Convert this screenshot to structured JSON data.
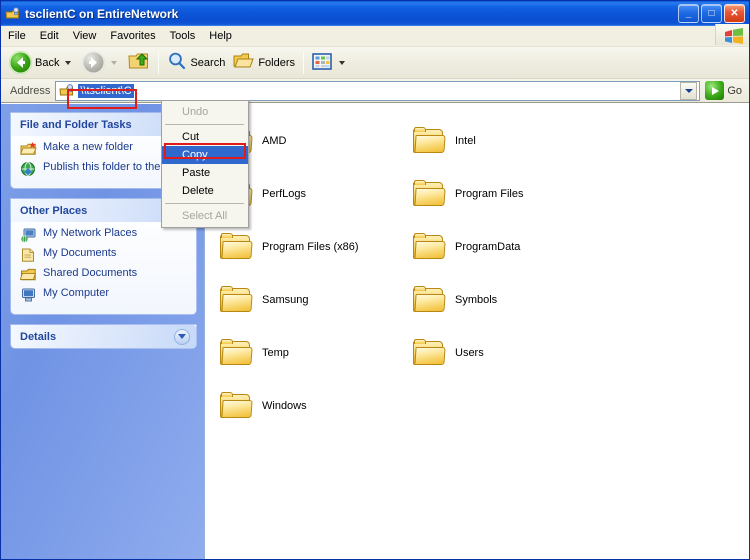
{
  "window": {
    "title": "tsclientC on EntireNetwork",
    "icon": "network-folder-icon",
    "controls": {
      "minimize": "_",
      "maximize": "□",
      "close": "✕"
    }
  },
  "menubar": {
    "items": [
      {
        "label": "File"
      },
      {
        "label": "Edit"
      },
      {
        "label": "View"
      },
      {
        "label": "Favorites"
      },
      {
        "label": "Tools"
      },
      {
        "label": "Help"
      }
    ],
    "logo": "windows-flag-icon"
  },
  "toolbar": {
    "back_label": "Back",
    "forward_label": "",
    "search_label": "Search",
    "folders_label": "Folders",
    "views_label": ""
  },
  "address": {
    "label": "Address",
    "value": "\\\\tsclient\\C",
    "go_label": "Go"
  },
  "sidebar": {
    "panels": [
      {
        "title": "File and Folder Tasks",
        "toggle": "collapse-up",
        "items": [
          {
            "icon": "new-folder-icon",
            "label": "Make a new folder"
          },
          {
            "icon": "publish-web-icon",
            "label": "Publish this folder to the Web"
          }
        ]
      },
      {
        "title": "Other Places",
        "toggle": "collapse-up",
        "items": [
          {
            "icon": "network-places-icon",
            "label": "My Network Places"
          },
          {
            "icon": "my-documents-icon",
            "label": "My Documents"
          },
          {
            "icon": "shared-documents-icon",
            "label": "Shared Documents"
          },
          {
            "icon": "my-computer-icon",
            "label": "My Computer"
          }
        ]
      },
      {
        "title": "Details",
        "toggle": "expand-down",
        "items": []
      }
    ]
  },
  "folders": [
    {
      "name": "AMD"
    },
    {
      "name": "Intel"
    },
    {
      "name": "PerfLogs"
    },
    {
      "name": "Program Files"
    },
    {
      "name": "Program Files (x86)"
    },
    {
      "name": "ProgramData"
    },
    {
      "name": "Samsung"
    },
    {
      "name": "Symbols"
    },
    {
      "name": "Temp"
    },
    {
      "name": "Users"
    },
    {
      "name": "Windows"
    }
  ],
  "context_menu": {
    "items": [
      {
        "label": "Undo",
        "state": "disabled"
      },
      {
        "label": "-separator-",
        "state": "separator"
      },
      {
        "label": "Cut",
        "state": "normal"
      },
      {
        "label": "Copy",
        "state": "selected"
      },
      {
        "label": "Paste",
        "state": "normal"
      },
      {
        "label": "Delete",
        "state": "normal"
      },
      {
        "label": "-separator-",
        "state": "separator"
      },
      {
        "label": "Select All",
        "state": "disabled"
      }
    ]
  },
  "annotations": {
    "color": "#E01B1B",
    "boxes": [
      {
        "name": "address-value-highlight"
      },
      {
        "name": "copy-item-highlight"
      }
    ]
  }
}
